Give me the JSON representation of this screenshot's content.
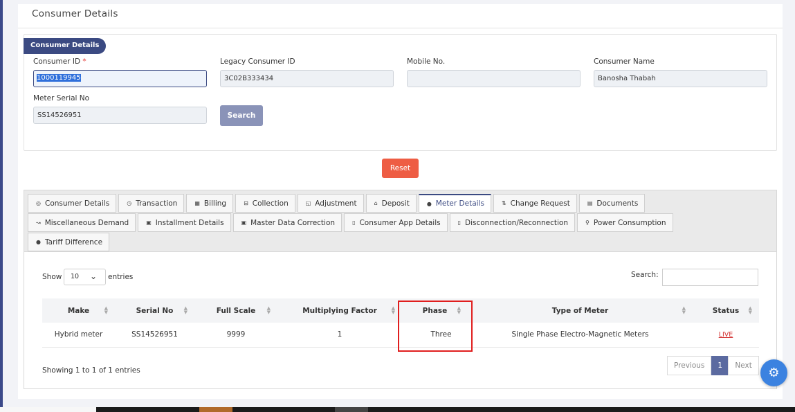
{
  "page": {
    "title": "Consumer Details"
  },
  "form": {
    "badge": "Consumer Details",
    "consumer_id": {
      "label": "Consumer ID",
      "required_mark": "*",
      "value": "1000119945"
    },
    "legacy_id": {
      "label": "Legacy Consumer ID",
      "value": "3C02B333434"
    },
    "mobile": {
      "label": "Mobile No.",
      "value": ""
    },
    "name": {
      "label": "Consumer Name",
      "value": "Banosha Thabah"
    },
    "meter_serial": {
      "label": "Meter Serial No",
      "value": "SS14526951"
    },
    "search_button": "Search",
    "reset_button": "Reset"
  },
  "tabs": {
    "row1": [
      {
        "icon": "◎",
        "label": "Consumer Details"
      },
      {
        "icon": "◷",
        "label": "Transaction"
      },
      {
        "icon": "▦",
        "label": "Billing"
      },
      {
        "icon": "⊟",
        "label": "Collection"
      },
      {
        "icon": "◱",
        "label": "Adjustment"
      },
      {
        "icon": "⌂",
        "label": "Deposit"
      },
      {
        "icon": "●",
        "label": "Meter Details"
      },
      {
        "icon": "⇅",
        "label": "Change Request"
      },
      {
        "icon": "▤",
        "label": "Documents"
      }
    ],
    "row2": [
      {
        "icon": "↝",
        "label": "Miscellaneous Demand"
      },
      {
        "icon": "▣",
        "label": "Installment Details"
      },
      {
        "icon": "▣",
        "label": "Master Data Correction"
      },
      {
        "icon": "▯",
        "label": "Consumer App Details"
      },
      {
        "icon": "▯",
        "label": "Disconnection/Reconnection"
      },
      {
        "icon": "♀",
        "label": "Power Consumption"
      }
    ],
    "row3": [
      {
        "icon": "●",
        "label": "Tariff Difference"
      }
    ],
    "active": "Meter Details"
  },
  "table_controls": {
    "show": "Show",
    "entries_value": "10",
    "entries": "entries",
    "search_label": "Search:"
  },
  "table": {
    "columns": [
      "Make",
      "Serial No",
      "Full Scale",
      "Multiplying Factor",
      "Phase",
      "Type of Meter",
      "Status"
    ],
    "rows": [
      [
        "Hybrid meter",
        "SS14526951",
        "9999",
        "1",
        "Three",
        "Single Phase Electro-Magnetic Meters",
        "LIVE"
      ]
    ]
  },
  "footer": {
    "info": "Showing 1 to 1 of 1 entries",
    "previous": "Previous",
    "page": "1",
    "next": "Next"
  },
  "colors": {
    "brand": "#3b4a82",
    "reset": "#ee5d44",
    "highlight": "#e01e1e",
    "status_live": "#d32f2f"
  }
}
